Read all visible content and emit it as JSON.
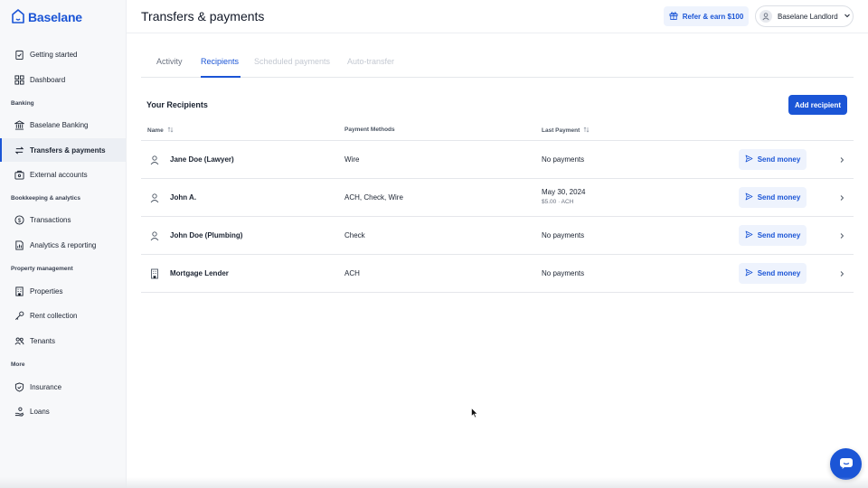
{
  "app": {
    "logo_text": "Baselane",
    "brand_color": "#1b55d6"
  },
  "sidebar": {
    "top_items": [
      {
        "label": "Getting started",
        "icon": "clipboard-check-icon"
      },
      {
        "label": "Dashboard",
        "icon": "grid-icon"
      }
    ],
    "sections": [
      {
        "label": "Banking",
        "items": [
          {
            "label": "Baselane Banking",
            "icon": "bank-icon"
          },
          {
            "label": "Transfers & payments",
            "icon": "transfer-icon",
            "active": true
          },
          {
            "label": "External accounts",
            "icon": "external-account-icon"
          }
        ]
      },
      {
        "label": "Bookkeeping & analytics",
        "items": [
          {
            "label": "Transactions",
            "icon": "dollar-circle-icon"
          },
          {
            "label": "Analytics & reporting",
            "icon": "report-icon"
          }
        ]
      },
      {
        "label": "Property management",
        "items": [
          {
            "label": "Properties",
            "icon": "building-icon"
          },
          {
            "label": "Rent collection",
            "icon": "key-icon"
          },
          {
            "label": "Tenants",
            "icon": "people-icon"
          }
        ]
      },
      {
        "label": "More",
        "items": [
          {
            "label": "Insurance",
            "icon": "shield-icon"
          },
          {
            "label": "Loans",
            "icon": "loan-icon"
          }
        ]
      }
    ]
  },
  "header": {
    "title": "Transfers & payments",
    "refer_label": "Refer & earn $100",
    "user_label": "Baselane Landlord"
  },
  "tabs": [
    {
      "label": "Activity",
      "state": "normal"
    },
    {
      "label": "Recipients",
      "state": "active"
    },
    {
      "label": "Scheduled payments",
      "state": "disabled"
    },
    {
      "label": "Auto-transfer",
      "state": "disabled"
    }
  ],
  "recipients": {
    "title": "Your Recipients",
    "add_button": "Add recipient",
    "columns": {
      "name": "Name",
      "methods": "Payment Methods",
      "last_payment": "Last Payment"
    },
    "send_label": "Send money",
    "rows": [
      {
        "name": "Jane Doe (Lawyer)",
        "icon": "person-icon",
        "methods": "Wire",
        "last_payment": "No payments",
        "sub": ""
      },
      {
        "name": "John A.",
        "icon": "person-icon",
        "methods": "ACH, Check, Wire",
        "last_payment": "May 30, 2024",
        "sub": "$5.00 · ACH"
      },
      {
        "name": "John Doe (Plumbing)",
        "icon": "person-icon",
        "methods": "Check",
        "last_payment": "No payments",
        "sub": ""
      },
      {
        "name": "Mortgage Lender",
        "icon": "building-icon",
        "methods": "ACH",
        "last_payment": "No payments",
        "sub": ""
      }
    ]
  }
}
